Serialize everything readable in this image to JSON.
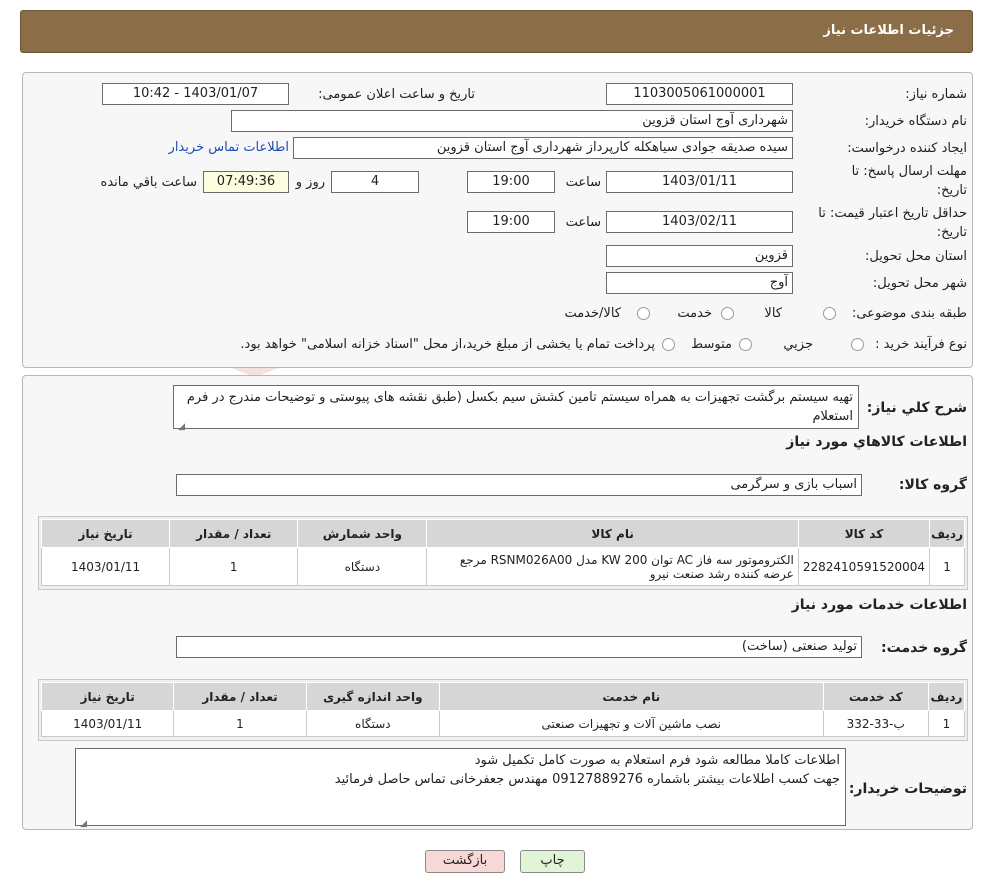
{
  "header": {
    "title": "جزئیات اطلاعات نیاز"
  },
  "form": {
    "need_number_label": "شماره نیاز:",
    "need_number": "1103005061000001",
    "announce_label": "تاریخ و ساعت اعلان عمومی:",
    "announce_value": "1403/01/07 - 10:42",
    "buyer_org_label": "نام دستگاه خریدار:",
    "buyer_org": "شهرداری آوج استان قزوین",
    "creator_label": "ایجاد کننده درخواست:",
    "creator": "سیده صدیقه جوادی سیاهکله کارپرداز شهرداری آوج استان قزوین",
    "contact_link": "اطلاعات تماس خریدار",
    "deadline_label_1": "مهلت ارسال پاسخ: تا",
    "deadline_label_2": "تاریخ:",
    "deadline_date": "1403/01/11",
    "time_label": "ساعت",
    "deadline_time": "19:00",
    "days_value": "4",
    "days_label": "روز و",
    "remaining_time": "07:49:36",
    "remaining_label": "ساعت باقي مانده",
    "validity_label_1": "حداقل تاریخ اعتبار قیمت: تا",
    "validity_label_2": "تاریخ:",
    "validity_date": "1403/02/11",
    "validity_time": "19:00",
    "province_label": "استان محل تحویل:",
    "province": "قزوین",
    "city_label": "شهر محل تحویل:",
    "city": "آوج",
    "category_label": "طبقه بندی موضوعی:",
    "category_options": [
      "کالا",
      "خدمت",
      "کالا/خدمت"
    ],
    "process_label": "نوع فرآیند خرید :",
    "process_options": [
      "جزیي",
      "متوسط"
    ],
    "process_note": "پرداخت تمام یا بخشی از مبلغ خرید،از محل \"اسناد خزانه اسلامی\" خواهد بود."
  },
  "description": {
    "label": "شرح کلي نیاز:",
    "text": "تهیه سیستم برگشت تجهیزات به همراه سیستم تامین کشش سیم بکسل (طبق نقشه های پیوستی و توضیحات مندرج در فرم استعلام"
  },
  "goods": {
    "title": "اطلاعات کالاهاي مورد نياز",
    "group_label": "گروه کالا:",
    "group_value": "اسباب بازی و سرگرمی",
    "headers": [
      "ردیف",
      "کد کالا",
      "نام کالا",
      "واحد شمارش",
      "تعداد / مقدار",
      "تاریخ نیاز"
    ],
    "rows": [
      [
        "1",
        "2282410591520004",
        "الکتروموتور سه فاز AC توان KW 200 مدل RSNM026A00 مرجع عرضه کننده رشد صنعت نیرو",
        "دستگاه",
        "1",
        "1403/01/11"
      ]
    ]
  },
  "services": {
    "title": "اطلاعات خدمات مورد نياز",
    "group_label": "گروه خدمت:",
    "group_value": "تولید صنعتی (ساخت)",
    "headers": [
      "ردیف",
      "کد خدمت",
      "نام خدمت",
      "واحد اندازه گیری",
      "تعداد / مقدار",
      "تاریخ نیاز"
    ],
    "rows": [
      [
        "1",
        "ب-33-332",
        "نصب ماشین آلات و تجهیزات صنعتی",
        "دستگاه",
        "1",
        "1403/01/11"
      ]
    ]
  },
  "buyer_notes": {
    "label": "توضیحات خریدار:",
    "line1": "اطلاعات کاملا مطالعه شود فرم استعلام به صورت کامل تکمیل شود",
    "line2": "جهت کسب اطلاعات بیشتر باشماره 09127889276 مهندس جعفرخانی تماس حاصل فرمائید"
  },
  "buttons": {
    "print": "چاپ",
    "back": "بازگشت"
  },
  "watermark": "AriaTender.neT",
  "colors": {
    "header_bg": "#8b6d47",
    "link": "#1a4fb8",
    "remaining_bg": "#fffde0",
    "back_btn": "#f8d7d7",
    "print_btn": "#e2f4d6"
  }
}
